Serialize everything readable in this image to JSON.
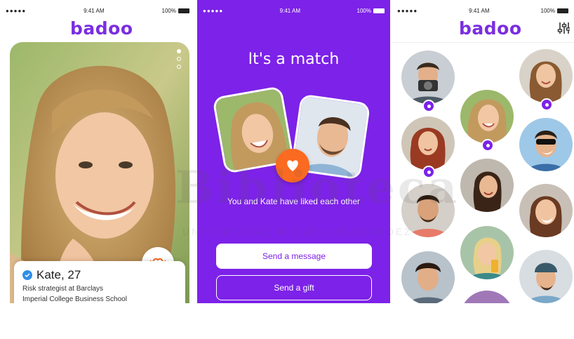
{
  "watermark": {
    "line1": "Biblioteca",
    "line2": "UNIVERSIDAD MIGUEL HERNANDEZ"
  },
  "screen1": {
    "status": {
      "signal": "●●●●● ",
      "time": "9:41 AM",
      "battery": "100%"
    },
    "brand": "badoo",
    "profile": {
      "name": "Kate, 27",
      "job": "Risk strategist at Barclays",
      "school": "Imperial College Business School"
    },
    "colors": {
      "brand": "#7a2ee0",
      "verified": "#2f8fe8"
    }
  },
  "screen2": {
    "status": {
      "signal": "●●●●● ",
      "time": "9:41 AM",
      "battery": "100%"
    },
    "title": "It's a match",
    "message": "You and Kate have liked each other",
    "primary_button": "Send a message",
    "secondary_button": "Send a gift",
    "colors": {
      "background": "#7d22e8",
      "heart": "#fb6a21"
    }
  },
  "screen3": {
    "status": {
      "signal": "●●●●● ",
      "time": "9:41 AM",
      "battery": "100%"
    },
    "brand": "badoo",
    "filter_icon": "sliders-icon",
    "people": [
      {
        "label": "man-with-camera",
        "pin": true
      },
      {
        "label": "woman-smiling",
        "pin": true
      },
      {
        "label": "kate",
        "pin": true
      },
      {
        "label": "woman-red-hair",
        "pin": true
      },
      {
        "label": "man-sunglasses",
        "pin": false
      },
      {
        "label": "woman-dark-hair",
        "pin": false
      },
      {
        "label": "man-beard",
        "pin": false
      },
      {
        "label": "woman-laughing",
        "pin": false
      },
      {
        "label": "woman-blonde-drink",
        "pin": false
      },
      {
        "label": "man-dark-hair",
        "pin": false
      },
      {
        "label": "man-beanie",
        "pin": false
      },
      {
        "label": "partial-avatar",
        "pin": false
      }
    ]
  }
}
